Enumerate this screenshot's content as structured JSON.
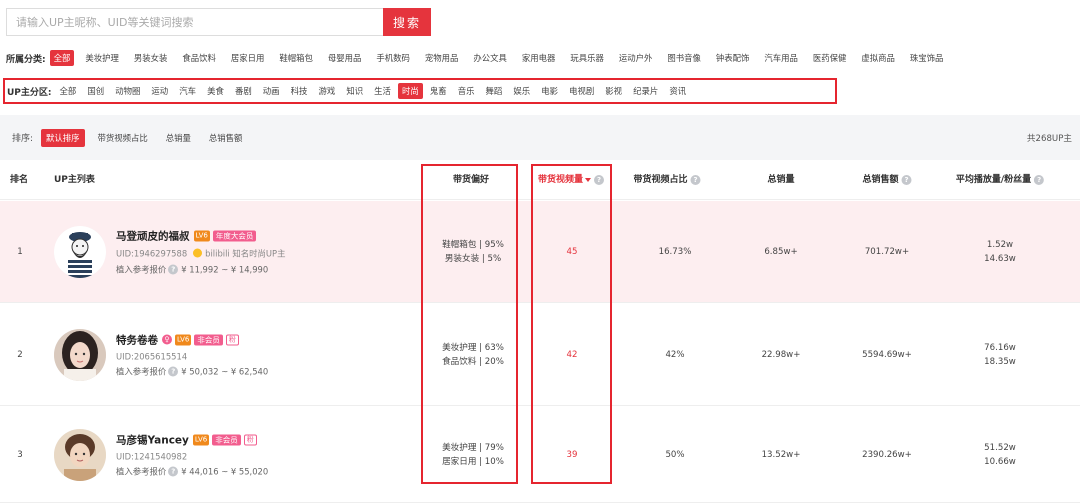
{
  "search": {
    "placeholder": "请输入UP主昵称、UID等关键词搜索",
    "button": "搜索"
  },
  "categories": {
    "label": "所属分类:",
    "items": [
      "全部",
      "美妆护理",
      "男装女装",
      "食品饮料",
      "居家日用",
      "鞋帽箱包",
      "母婴用品",
      "手机数码",
      "宠物用品",
      "办公文具",
      "家用电器",
      "玩具乐器",
      "运动户外",
      "图书音像",
      "钟表配饰",
      "汽车用品",
      "医药保健",
      "虚拟商品",
      "珠宝饰品"
    ],
    "active_index": 0
  },
  "zones": {
    "label": "UP主分区:",
    "items": [
      "全部",
      "国创",
      "动物圈",
      "运动",
      "汽车",
      "美食",
      "番剧",
      "动画",
      "科技",
      "游戏",
      "知识",
      "生活",
      "时尚",
      "鬼畜",
      "音乐",
      "舞蹈",
      "娱乐",
      "电影",
      "电视剧",
      "影视",
      "纪录片",
      "资讯"
    ],
    "active_index": 12
  },
  "sort": {
    "label": "排序:",
    "options": [
      "默认排序",
      "带货视频占比",
      "总销量",
      "总销售额"
    ],
    "active_index": 0,
    "total": "共268UP主"
  },
  "columns": {
    "rank": "排名",
    "up_list": "UP主列表",
    "preference": "带货偏好",
    "video_count": "带货视频量",
    "video_ratio": "带货视频占比",
    "total_sales": "总销量",
    "total_revenue": "总销售额",
    "avg_play": "平均播放量/粉丝量"
  },
  "rows": [
    {
      "rank": "1",
      "name": "马登顽皮的福叔",
      "level": "LV6",
      "vip": "年度大会员",
      "uid": "UID:1946297588",
      "cert": "bilibili 知名时尚UP主",
      "price_label": "植入参考报价",
      "price": "¥ 11,992 ~ ¥ 14,990",
      "pref1": "鞋帽箱包 | 95%",
      "pref2": "男装女装 | 5%",
      "video_count": "45",
      "video_ratio": "16.73%",
      "total_sales": "6.85w+",
      "total_revenue": "701.72w+",
      "avg_play": "1.52w",
      "fans": "14.63w"
    },
    {
      "rank": "2",
      "name": "特务卷卷",
      "level": "LV6",
      "vip": "非会员",
      "fan": "粉",
      "uid": "UID:2065615514",
      "price_label": "植入参考报价",
      "price": "¥ 50,032 ~ ¥ 62,540",
      "pref1": "美妆护理 | 63%",
      "pref2": "食品饮料 | 20%",
      "video_count": "42",
      "video_ratio": "42%",
      "total_sales": "22.98w+",
      "total_revenue": "5594.69w+",
      "avg_play": "76.16w",
      "fans": "18.35w"
    },
    {
      "rank": "3",
      "name": "马彦锡Yancey",
      "level": "LV6",
      "vip": "非会员",
      "fan": "粉",
      "uid": "UID:1241540982",
      "price_label": "植入参考报价",
      "price": "¥ 44,016 ~ ¥ 55,020",
      "pref1": "美妆护理 | 79%",
      "pref2": "居家日用 | 10%",
      "video_count": "39",
      "video_ratio": "50%",
      "total_sales": "13.52w+",
      "total_revenue": "2390.26w+",
      "avg_play": "51.52w",
      "fans": "10.66w"
    }
  ],
  "colors": {
    "accent": "#e5343d",
    "highlight_row": "#fdeef0",
    "vip": "#f25d8e",
    "level": "#f0891c"
  }
}
